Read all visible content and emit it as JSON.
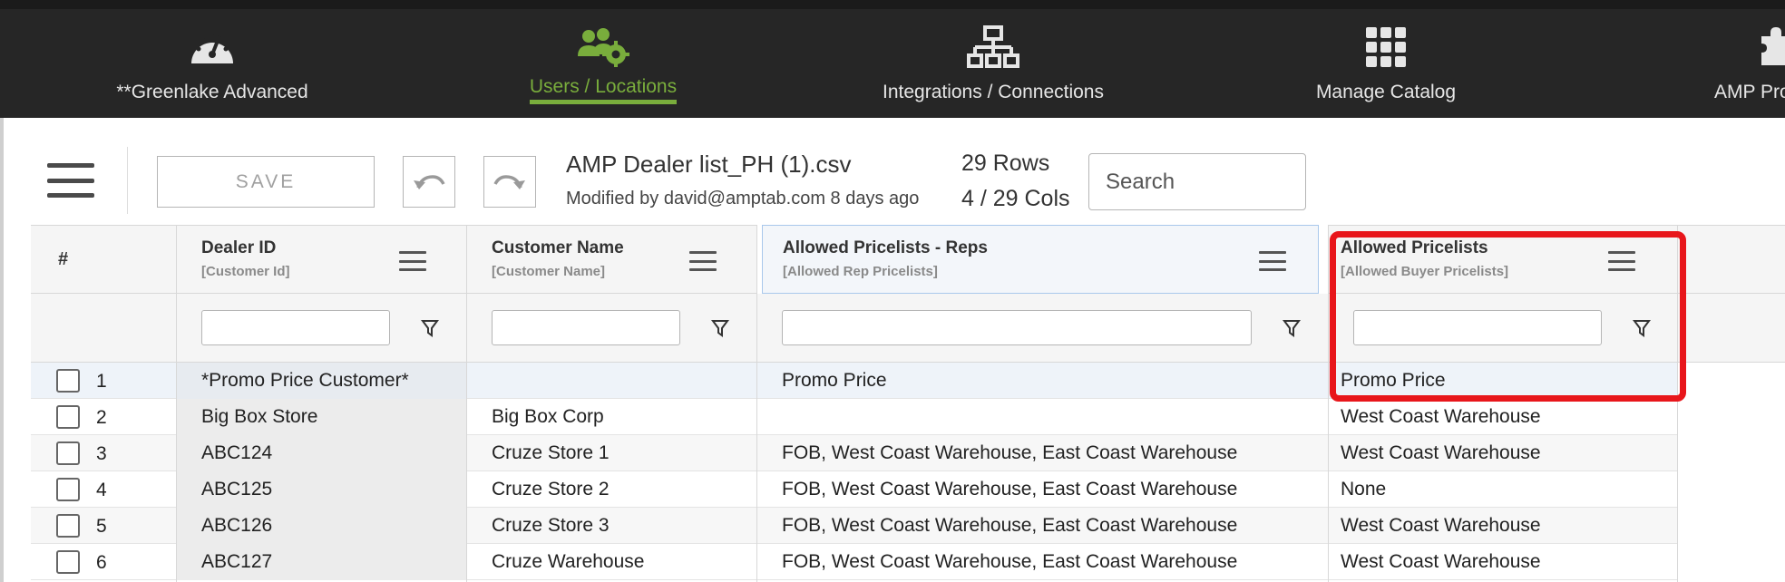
{
  "nav": {
    "items": [
      {
        "label": "**Greenlake Advanced",
        "icon": "speedometer-icon",
        "active": false
      },
      {
        "label": "Users / Locations",
        "icon": "users-gear-icon",
        "active": true
      },
      {
        "label": "Integrations / Connections",
        "icon": "network-icon",
        "active": false
      },
      {
        "label": "Manage Catalog",
        "icon": "grid-icon",
        "active": false
      },
      {
        "label": "AMP Pro",
        "icon": "puzzle-icon",
        "active": false
      }
    ],
    "active_color": "#79ad3c"
  },
  "toolbar": {
    "save_label": "SAVE",
    "file_name": "AMP Dealer list_PH (1).csv",
    "modified": "Modified by david@amptab.com 8 days ago",
    "rows": "29 Rows",
    "cols": "4 / 29 Cols",
    "search_placeholder": "Search"
  },
  "grid": {
    "row_num_header": "#",
    "columns": [
      {
        "title": "Dealer ID",
        "sub": "[Customer Id]"
      },
      {
        "title": "Customer Name",
        "sub": "[Customer Name]"
      },
      {
        "title": "Allowed Pricelists - Reps",
        "sub": "[Allowed Rep Pricelists]"
      },
      {
        "title": "Allowed Pricelists",
        "sub": "[Allowed Buyer Pricelists]"
      }
    ],
    "rows": [
      {
        "num": "1",
        "c": [
          "*Promo Price Customer*",
          "",
          "Promo Price",
          "Promo Price"
        ]
      },
      {
        "num": "2",
        "c": [
          "Big Box Store",
          "Big Box Corp",
          "",
          "West Coast Warehouse"
        ]
      },
      {
        "num": "3",
        "c": [
          "ABC124",
          "Cruze Store 1",
          "FOB, West Coast Warehouse, East Coast Warehouse",
          "West Coast Warehouse"
        ]
      },
      {
        "num": "4",
        "c": [
          "ABC125",
          "Cruze Store 2",
          "FOB, West Coast Warehouse, East Coast Warehouse",
          "None"
        ]
      },
      {
        "num": "5",
        "c": [
          "ABC126",
          "Cruze Store 3",
          "FOB, West Coast Warehouse, East Coast Warehouse",
          "West Coast Warehouse"
        ]
      },
      {
        "num": "6",
        "c": [
          "ABC127",
          "Cruze Warehouse",
          "FOB, West Coast Warehouse, East Coast Warehouse",
          "West Coast Warehouse"
        ]
      }
    ]
  },
  "highlight_color": "#e8161b"
}
